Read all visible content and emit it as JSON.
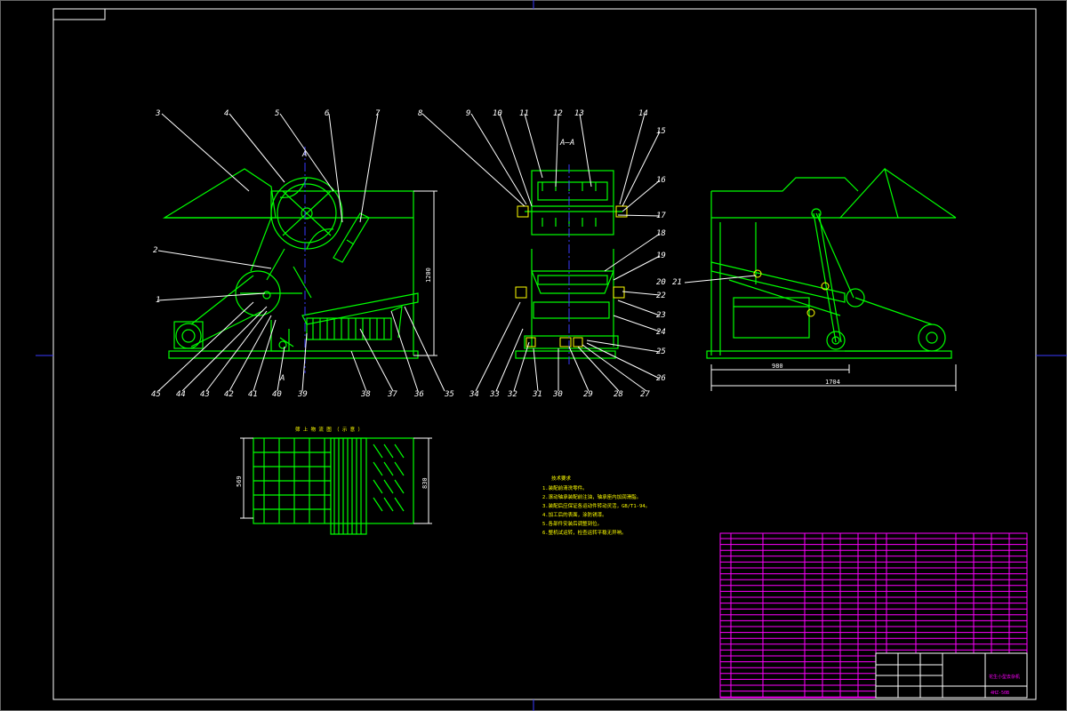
{
  "drawing": {
    "section_label": "A–A",
    "section_marker": "A",
    "part_numbers": [
      "1",
      "2",
      "3",
      "4",
      "5",
      "6",
      "7",
      "8",
      "9",
      "10",
      "11",
      "12",
      "13",
      "14",
      "15",
      "16",
      "17",
      "18",
      "19",
      "20",
      "21",
      "22",
      "23",
      "24",
      "25",
      "26",
      "27",
      "28",
      "29",
      "30",
      "31",
      "32",
      "33",
      "34",
      "35",
      "36",
      "37",
      "38",
      "39",
      "40",
      "41",
      "42",
      "43",
      "44",
      "45"
    ],
    "dimensions": {
      "height": "1200",
      "width_a": "980",
      "width_b": "1704",
      "screen_height_a": "569",
      "screen_height_b": "830"
    },
    "detail_title": "筛 上 物 流 图 （ 示 意 ）",
    "notes_title": "技术要求",
    "notes": [
      "1.装配前清洗零件。",
      "2.滚动轴承装配前注油，轴承座内加润滑脂。",
      "3.装配后应保证各运动件转动灵活，GB/T1-94。",
      "4.加工后的表面，涂防锈漆。",
      "5.各部件安装后调整到位。",
      "6.整机试运转，检查运转平稳无异响。"
    ],
    "title_block": {
      "drawing_name": "花生小型去杂机",
      "drawing_number": "4HZ-50B"
    }
  },
  "colors": {
    "background": "#000000",
    "frame": "#ffffff",
    "outline": "#00ff00",
    "hidden": "#3a3aff",
    "table": "#ff00ff",
    "text": "#ffff00"
  }
}
